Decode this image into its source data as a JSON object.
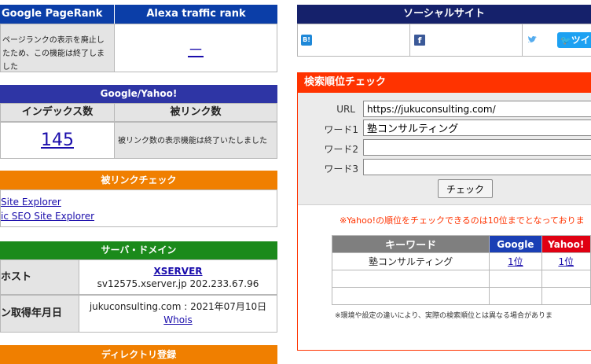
{
  "pagerank": {
    "title_left": "Google PageRank",
    "title_right": "Alexa traffic rank",
    "left_text": "ページランクの表示を廃止したため、この機能は終了しました",
    "right_value": "－"
  },
  "google_yahoo": {
    "title": "Google/Yahoo!",
    "col_index": "インデックス数",
    "col_backlinks": "被リンク数",
    "index_value": "145",
    "backlinks_text": "被リンク数の表示機能は終了いたしました"
  },
  "backlink_check": {
    "title": "被リンクチェック",
    "links": [
      "Site Explorer",
      "ic SEO Site Explorer"
    ]
  },
  "server": {
    "title": "サーバ・ドメイン",
    "host_label": "ホスト",
    "host_name": "XSERVER",
    "host_detail": "sv12575.xserver.jp 202.233.67.96",
    "domain_label": "ン取得年月日",
    "domain_detail": "jukuconsulting.com : 2021年07月10日",
    "whois": "Whois"
  },
  "directory": {
    "title": "ディレクトリ登録"
  },
  "social": {
    "title": "ソーシャルサイト",
    "tweet_label": "ツイ"
  },
  "search_check": {
    "title": "検索順位チェック",
    "url_label": "URL",
    "url_value": "https://jukuconsulting.com/",
    "word1_label": "ワード1",
    "word1_value": "塾コンサルティング",
    "word2_label": "ワード2",
    "word3_label": "ワード3",
    "check_button": "チェック",
    "notice": "※Yahoo!の順位をチェックできるのは10位までとなっておりま",
    "table_headers": {
      "keyword": "キーワード",
      "google": "Google",
      "yahoo": "Yahoo!"
    },
    "rows": [
      {
        "keyword": "塾コンサルティング",
        "google": "1位",
        "yahoo": "1位"
      }
    ],
    "footnote": "※環境や設定の違いにより、実際の検索順位とは異なる場合がありま"
  },
  "colors": {
    "blue_header": "#0b3ea8",
    "purple_header": "#2e35a5",
    "orange_header": "#f07f00",
    "green_header": "#1b8a1b",
    "navy_header": "#15216b",
    "red_header": "#ff3300"
  }
}
